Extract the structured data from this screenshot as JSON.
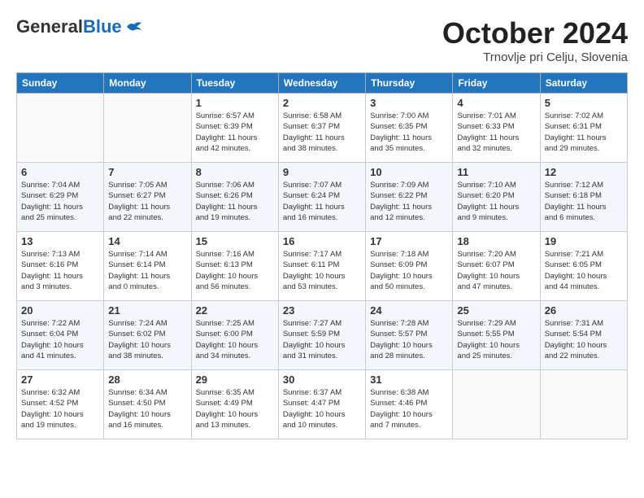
{
  "header": {
    "logo_general": "General",
    "logo_blue": "Blue",
    "month_title": "October 2024",
    "location": "Trnovlje pri Celju, Slovenia"
  },
  "weekdays": [
    "Sunday",
    "Monday",
    "Tuesday",
    "Wednesday",
    "Thursday",
    "Friday",
    "Saturday"
  ],
  "weeks": [
    [
      {
        "day": "",
        "info": ""
      },
      {
        "day": "",
        "info": ""
      },
      {
        "day": "1",
        "info": "Sunrise: 6:57 AM\nSunset: 6:39 PM\nDaylight: 11 hours\nand 42 minutes."
      },
      {
        "day": "2",
        "info": "Sunrise: 6:58 AM\nSunset: 6:37 PM\nDaylight: 11 hours\nand 38 minutes."
      },
      {
        "day": "3",
        "info": "Sunrise: 7:00 AM\nSunset: 6:35 PM\nDaylight: 11 hours\nand 35 minutes."
      },
      {
        "day": "4",
        "info": "Sunrise: 7:01 AM\nSunset: 6:33 PM\nDaylight: 11 hours\nand 32 minutes."
      },
      {
        "day": "5",
        "info": "Sunrise: 7:02 AM\nSunset: 6:31 PM\nDaylight: 11 hours\nand 29 minutes."
      }
    ],
    [
      {
        "day": "6",
        "info": "Sunrise: 7:04 AM\nSunset: 6:29 PM\nDaylight: 11 hours\nand 25 minutes."
      },
      {
        "day": "7",
        "info": "Sunrise: 7:05 AM\nSunset: 6:27 PM\nDaylight: 11 hours\nand 22 minutes."
      },
      {
        "day": "8",
        "info": "Sunrise: 7:06 AM\nSunset: 6:26 PM\nDaylight: 11 hours\nand 19 minutes."
      },
      {
        "day": "9",
        "info": "Sunrise: 7:07 AM\nSunset: 6:24 PM\nDaylight: 11 hours\nand 16 minutes."
      },
      {
        "day": "10",
        "info": "Sunrise: 7:09 AM\nSunset: 6:22 PM\nDaylight: 11 hours\nand 12 minutes."
      },
      {
        "day": "11",
        "info": "Sunrise: 7:10 AM\nSunset: 6:20 PM\nDaylight: 11 hours\nand 9 minutes."
      },
      {
        "day": "12",
        "info": "Sunrise: 7:12 AM\nSunset: 6:18 PM\nDaylight: 11 hours\nand 6 minutes."
      }
    ],
    [
      {
        "day": "13",
        "info": "Sunrise: 7:13 AM\nSunset: 6:16 PM\nDaylight: 11 hours\nand 3 minutes."
      },
      {
        "day": "14",
        "info": "Sunrise: 7:14 AM\nSunset: 6:14 PM\nDaylight: 11 hours\nand 0 minutes."
      },
      {
        "day": "15",
        "info": "Sunrise: 7:16 AM\nSunset: 6:13 PM\nDaylight: 10 hours\nand 56 minutes."
      },
      {
        "day": "16",
        "info": "Sunrise: 7:17 AM\nSunset: 6:11 PM\nDaylight: 10 hours\nand 53 minutes."
      },
      {
        "day": "17",
        "info": "Sunrise: 7:18 AM\nSunset: 6:09 PM\nDaylight: 10 hours\nand 50 minutes."
      },
      {
        "day": "18",
        "info": "Sunrise: 7:20 AM\nSunset: 6:07 PM\nDaylight: 10 hours\nand 47 minutes."
      },
      {
        "day": "19",
        "info": "Sunrise: 7:21 AM\nSunset: 6:05 PM\nDaylight: 10 hours\nand 44 minutes."
      }
    ],
    [
      {
        "day": "20",
        "info": "Sunrise: 7:22 AM\nSunset: 6:04 PM\nDaylight: 10 hours\nand 41 minutes."
      },
      {
        "day": "21",
        "info": "Sunrise: 7:24 AM\nSunset: 6:02 PM\nDaylight: 10 hours\nand 38 minutes."
      },
      {
        "day": "22",
        "info": "Sunrise: 7:25 AM\nSunset: 6:00 PM\nDaylight: 10 hours\nand 34 minutes."
      },
      {
        "day": "23",
        "info": "Sunrise: 7:27 AM\nSunset: 5:59 PM\nDaylight: 10 hours\nand 31 minutes."
      },
      {
        "day": "24",
        "info": "Sunrise: 7:28 AM\nSunset: 5:57 PM\nDaylight: 10 hours\nand 28 minutes."
      },
      {
        "day": "25",
        "info": "Sunrise: 7:29 AM\nSunset: 5:55 PM\nDaylight: 10 hours\nand 25 minutes."
      },
      {
        "day": "26",
        "info": "Sunrise: 7:31 AM\nSunset: 5:54 PM\nDaylight: 10 hours\nand 22 minutes."
      }
    ],
    [
      {
        "day": "27",
        "info": "Sunrise: 6:32 AM\nSunset: 4:52 PM\nDaylight: 10 hours\nand 19 minutes."
      },
      {
        "day": "28",
        "info": "Sunrise: 6:34 AM\nSunset: 4:50 PM\nDaylight: 10 hours\nand 16 minutes."
      },
      {
        "day": "29",
        "info": "Sunrise: 6:35 AM\nSunset: 4:49 PM\nDaylight: 10 hours\nand 13 minutes."
      },
      {
        "day": "30",
        "info": "Sunrise: 6:37 AM\nSunset: 4:47 PM\nDaylight: 10 hours\nand 10 minutes."
      },
      {
        "day": "31",
        "info": "Sunrise: 6:38 AM\nSunset: 4:46 PM\nDaylight: 10 hours\nand 7 minutes."
      },
      {
        "day": "",
        "info": ""
      },
      {
        "day": "",
        "info": ""
      }
    ]
  ]
}
